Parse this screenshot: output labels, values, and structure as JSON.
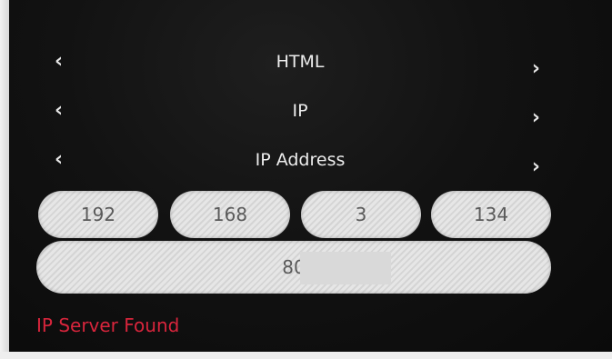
{
  "menu": {
    "rows": [
      {
        "prev_glyph": "‹",
        "label": "HTML",
        "next_glyph": "›"
      },
      {
        "prev_glyph": "‹",
        "label": "IP",
        "next_glyph": "›"
      },
      {
        "prev_glyph": "‹",
        "label": "IP Address",
        "next_glyph": "›"
      }
    ]
  },
  "ip_address": {
    "octets": [
      "192",
      "168",
      "3",
      "134"
    ]
  },
  "port": {
    "value": "80"
  },
  "status": {
    "text": "IP Server Found",
    "color": "#d8253c"
  }
}
